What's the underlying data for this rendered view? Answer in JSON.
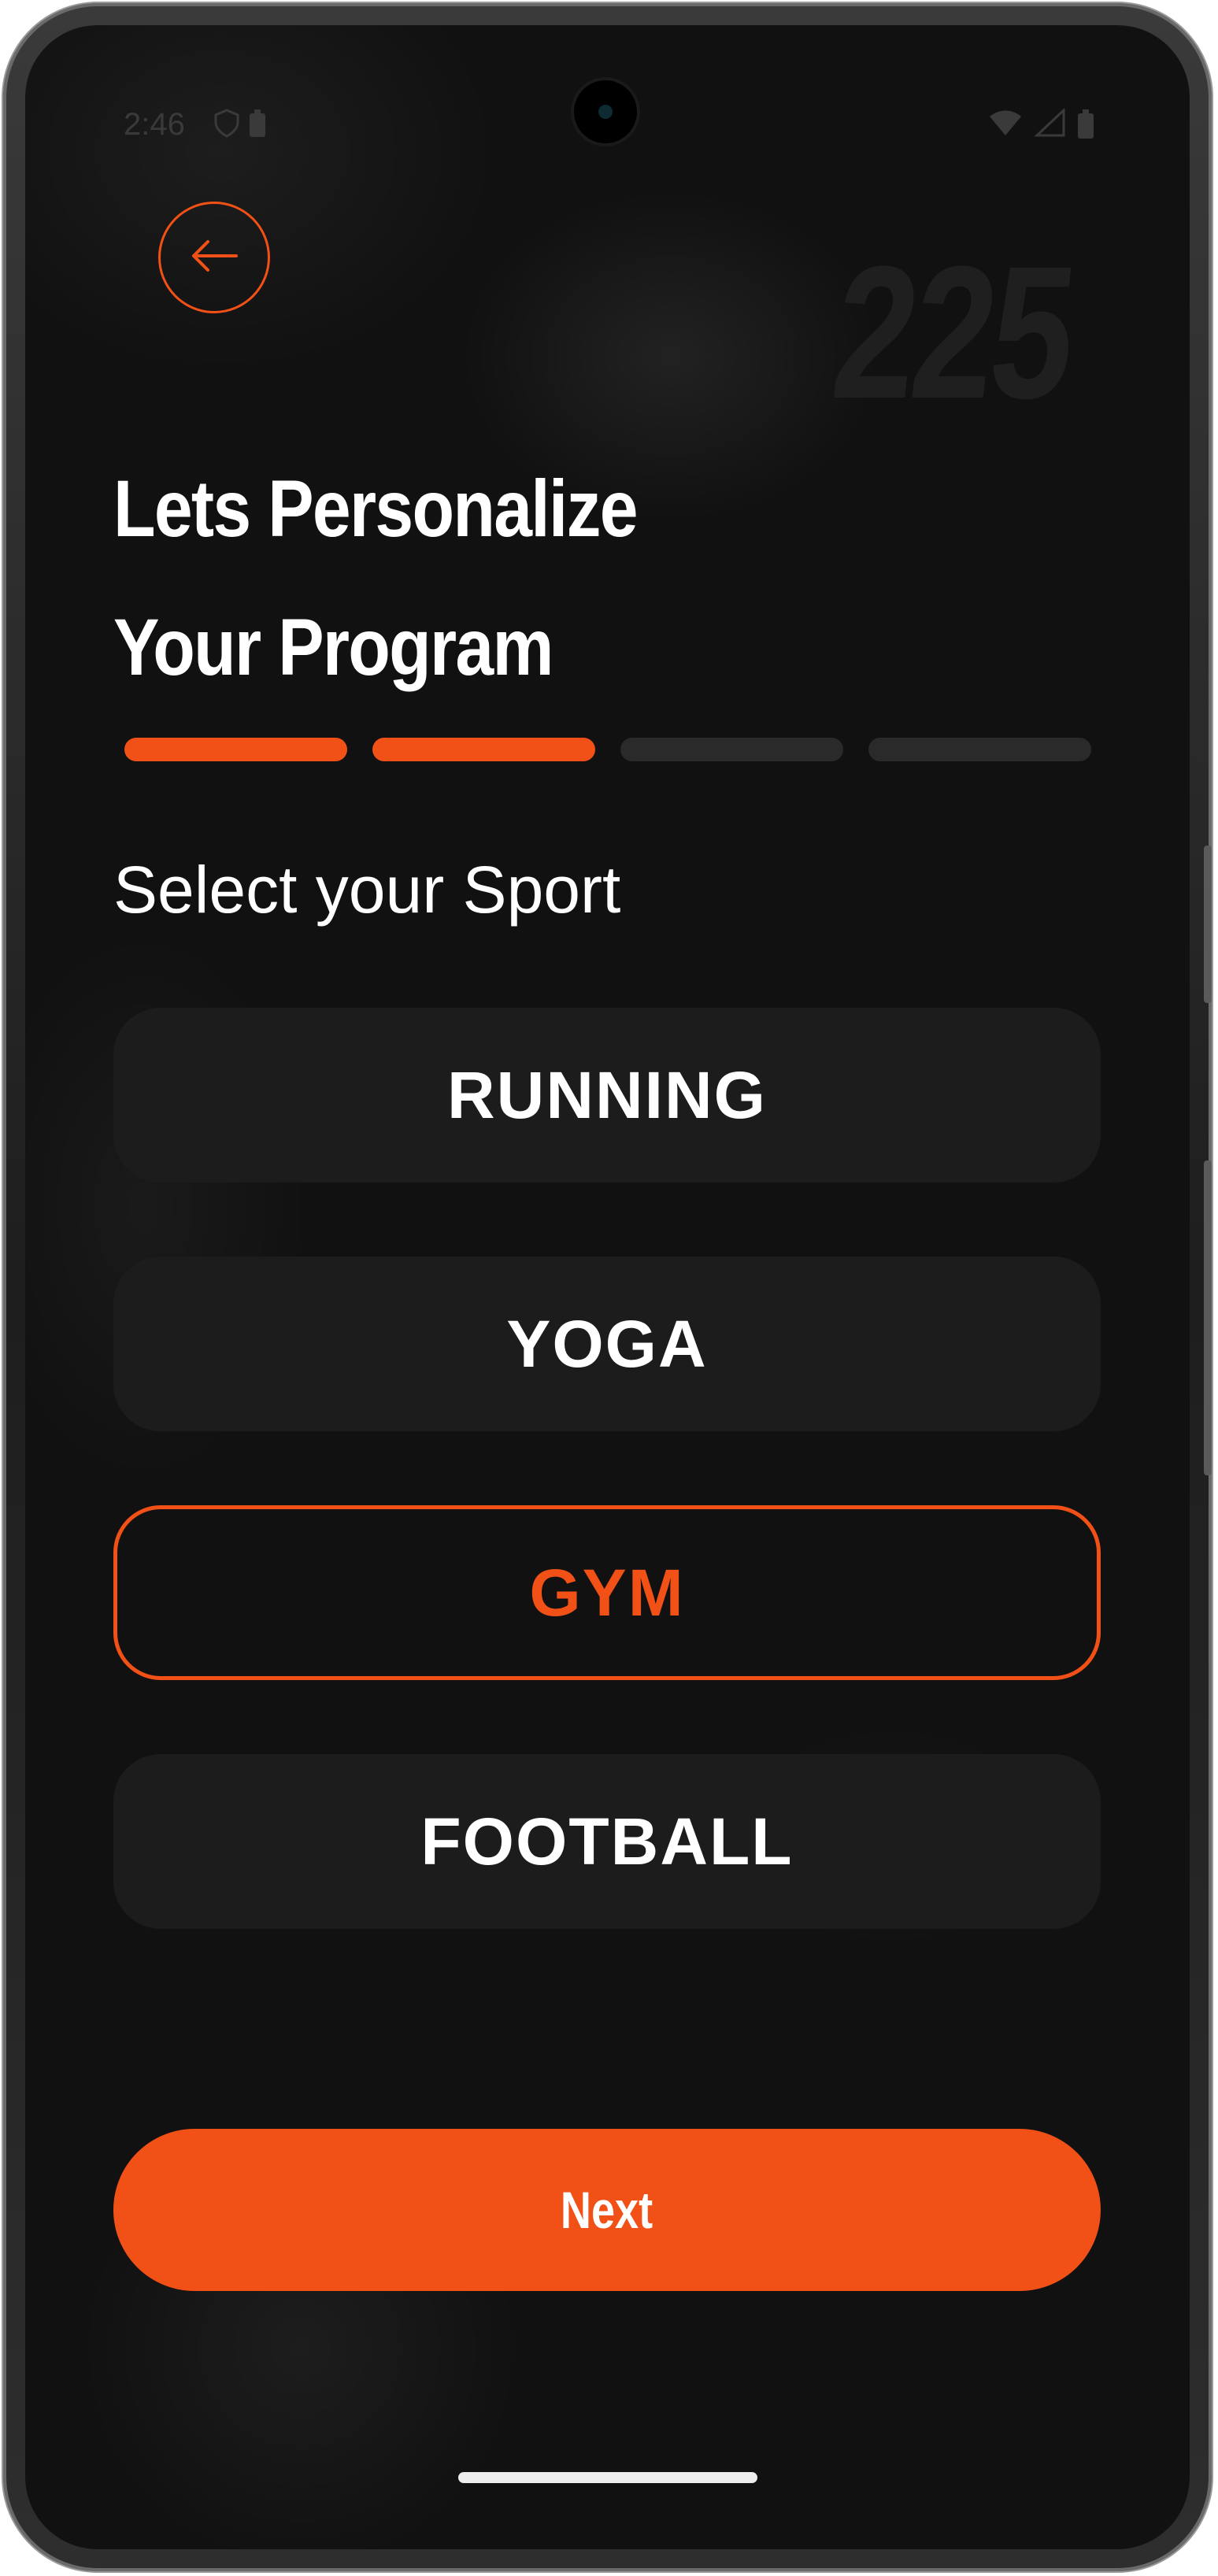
{
  "status_bar": {
    "time": "2:46",
    "left_icons": [
      "shield-icon",
      "battery-saver-icon"
    ],
    "right_icons": [
      "wifi-icon",
      "cellular-icon",
      "battery-icon"
    ]
  },
  "header": {
    "back_icon": "arrow-left-icon",
    "background_number": "225",
    "title_line1": "Lets Personalize",
    "title_line2": "Your Program"
  },
  "progress": {
    "total_steps": 4,
    "completed_steps": 2
  },
  "section": {
    "label": "Select your Sport"
  },
  "options": [
    {
      "label": "RUNNING",
      "selected": false
    },
    {
      "label": "YOGA",
      "selected": false
    },
    {
      "label": "GYM",
      "selected": true
    },
    {
      "label": "FOOTBALL",
      "selected": false
    }
  ],
  "next_button": {
    "label": "Next"
  },
  "colors": {
    "accent": "#f15116",
    "background": "#111111",
    "option_bg": "#1c1c1c",
    "inactive_progress": "#2a2a2a"
  }
}
